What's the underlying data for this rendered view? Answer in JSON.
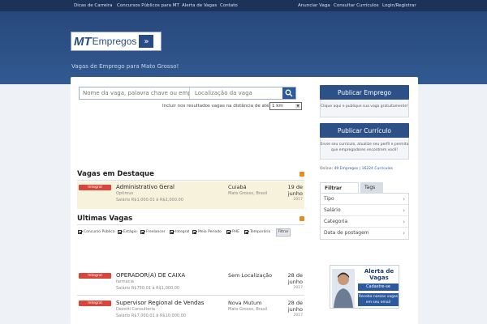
{
  "topnav": {
    "left": [
      "Dicas de Carreira",
      "Concursos Públicos para MT",
      "Alerta de Vagas",
      "Contato"
    ],
    "right": [
      "Anunciar Vaga",
      "Consultar Currículos",
      "Login/Registrar"
    ]
  },
  "header": {
    "logo_mt": "MT",
    "logo_empregos": "Empregos",
    "logo_arrow": "»",
    "tagline": "Vagas de Emprego para Mato Grosso!"
  },
  "search": {
    "keyword_placeholder": "Nome da vaga, palavra chave ou empresa",
    "location_placeholder": "Localização da vaga",
    "distance_label": "Incluir nos resultados vagas na distância de até",
    "distance_value": "1 km"
  },
  "sidebar": {
    "publish_job": "Publicar Emprego",
    "publish_job_sub": "Clique aqui e publique sua vaga gratuitamente!",
    "publish_cv": "Publicar Currículo",
    "publish_cv_sub": "Envie seu currículo, atualize seu perfil e permita que empregadores encontrem você!",
    "online_prefix": "Online: ",
    "online_jobs": "49 Empregos",
    "online_sep": " | ",
    "online_cvs": "16224 Currículos",
    "filter_tab": "Filtrar por...",
    "tags_tab": "Tags",
    "filters": [
      "Tipo",
      "Salário",
      "Categoria",
      "Data de postagem"
    ],
    "alert_ad": {
      "title": "Alerta de Vagas",
      "cta": "Cadastre-se",
      "sub": "Receba nossas vagas em seu email"
    }
  },
  "featured": {
    "title": "Vagas em Destaque",
    "jobs": [
      {
        "badge": "Integral",
        "title": "Administrativo Geral",
        "company": "Optimus",
        "salary": "Salário R$1,000.01 à R$2,000.00",
        "city": "Cuiabá",
        "region": "Mato Grosso, Brasil",
        "date": "19 de junho",
        "year": "2017"
      }
    ]
  },
  "latest": {
    "title": "Ultimas Vagas",
    "types": [
      "Concurso Público",
      "Estágio",
      "Freelancer",
      "Integral",
      "Meio Período",
      "PHE",
      "Temporário"
    ],
    "filter_button": "Filtrar",
    "jobs": [
      {
        "badge": "Integral",
        "title": "OPERADOR(A) DE CAIXA",
        "company": "farmacia",
        "salary": "Salário R$750,01 à R$1,000,00",
        "city": "Sem Localização",
        "region": "",
        "date": "28 de junho",
        "year": "2017"
      },
      {
        "badge": "Integral",
        "title": "Supervisor Regional de Vendas",
        "company": "Dezotti Consultoria",
        "salary": "Salário R$7,000,01 à R$10,000,00",
        "city": "Nova Mutum",
        "region": "Mato Grosso, Brasil",
        "date": "28 de junho",
        "year": "2017"
      }
    ]
  }
}
